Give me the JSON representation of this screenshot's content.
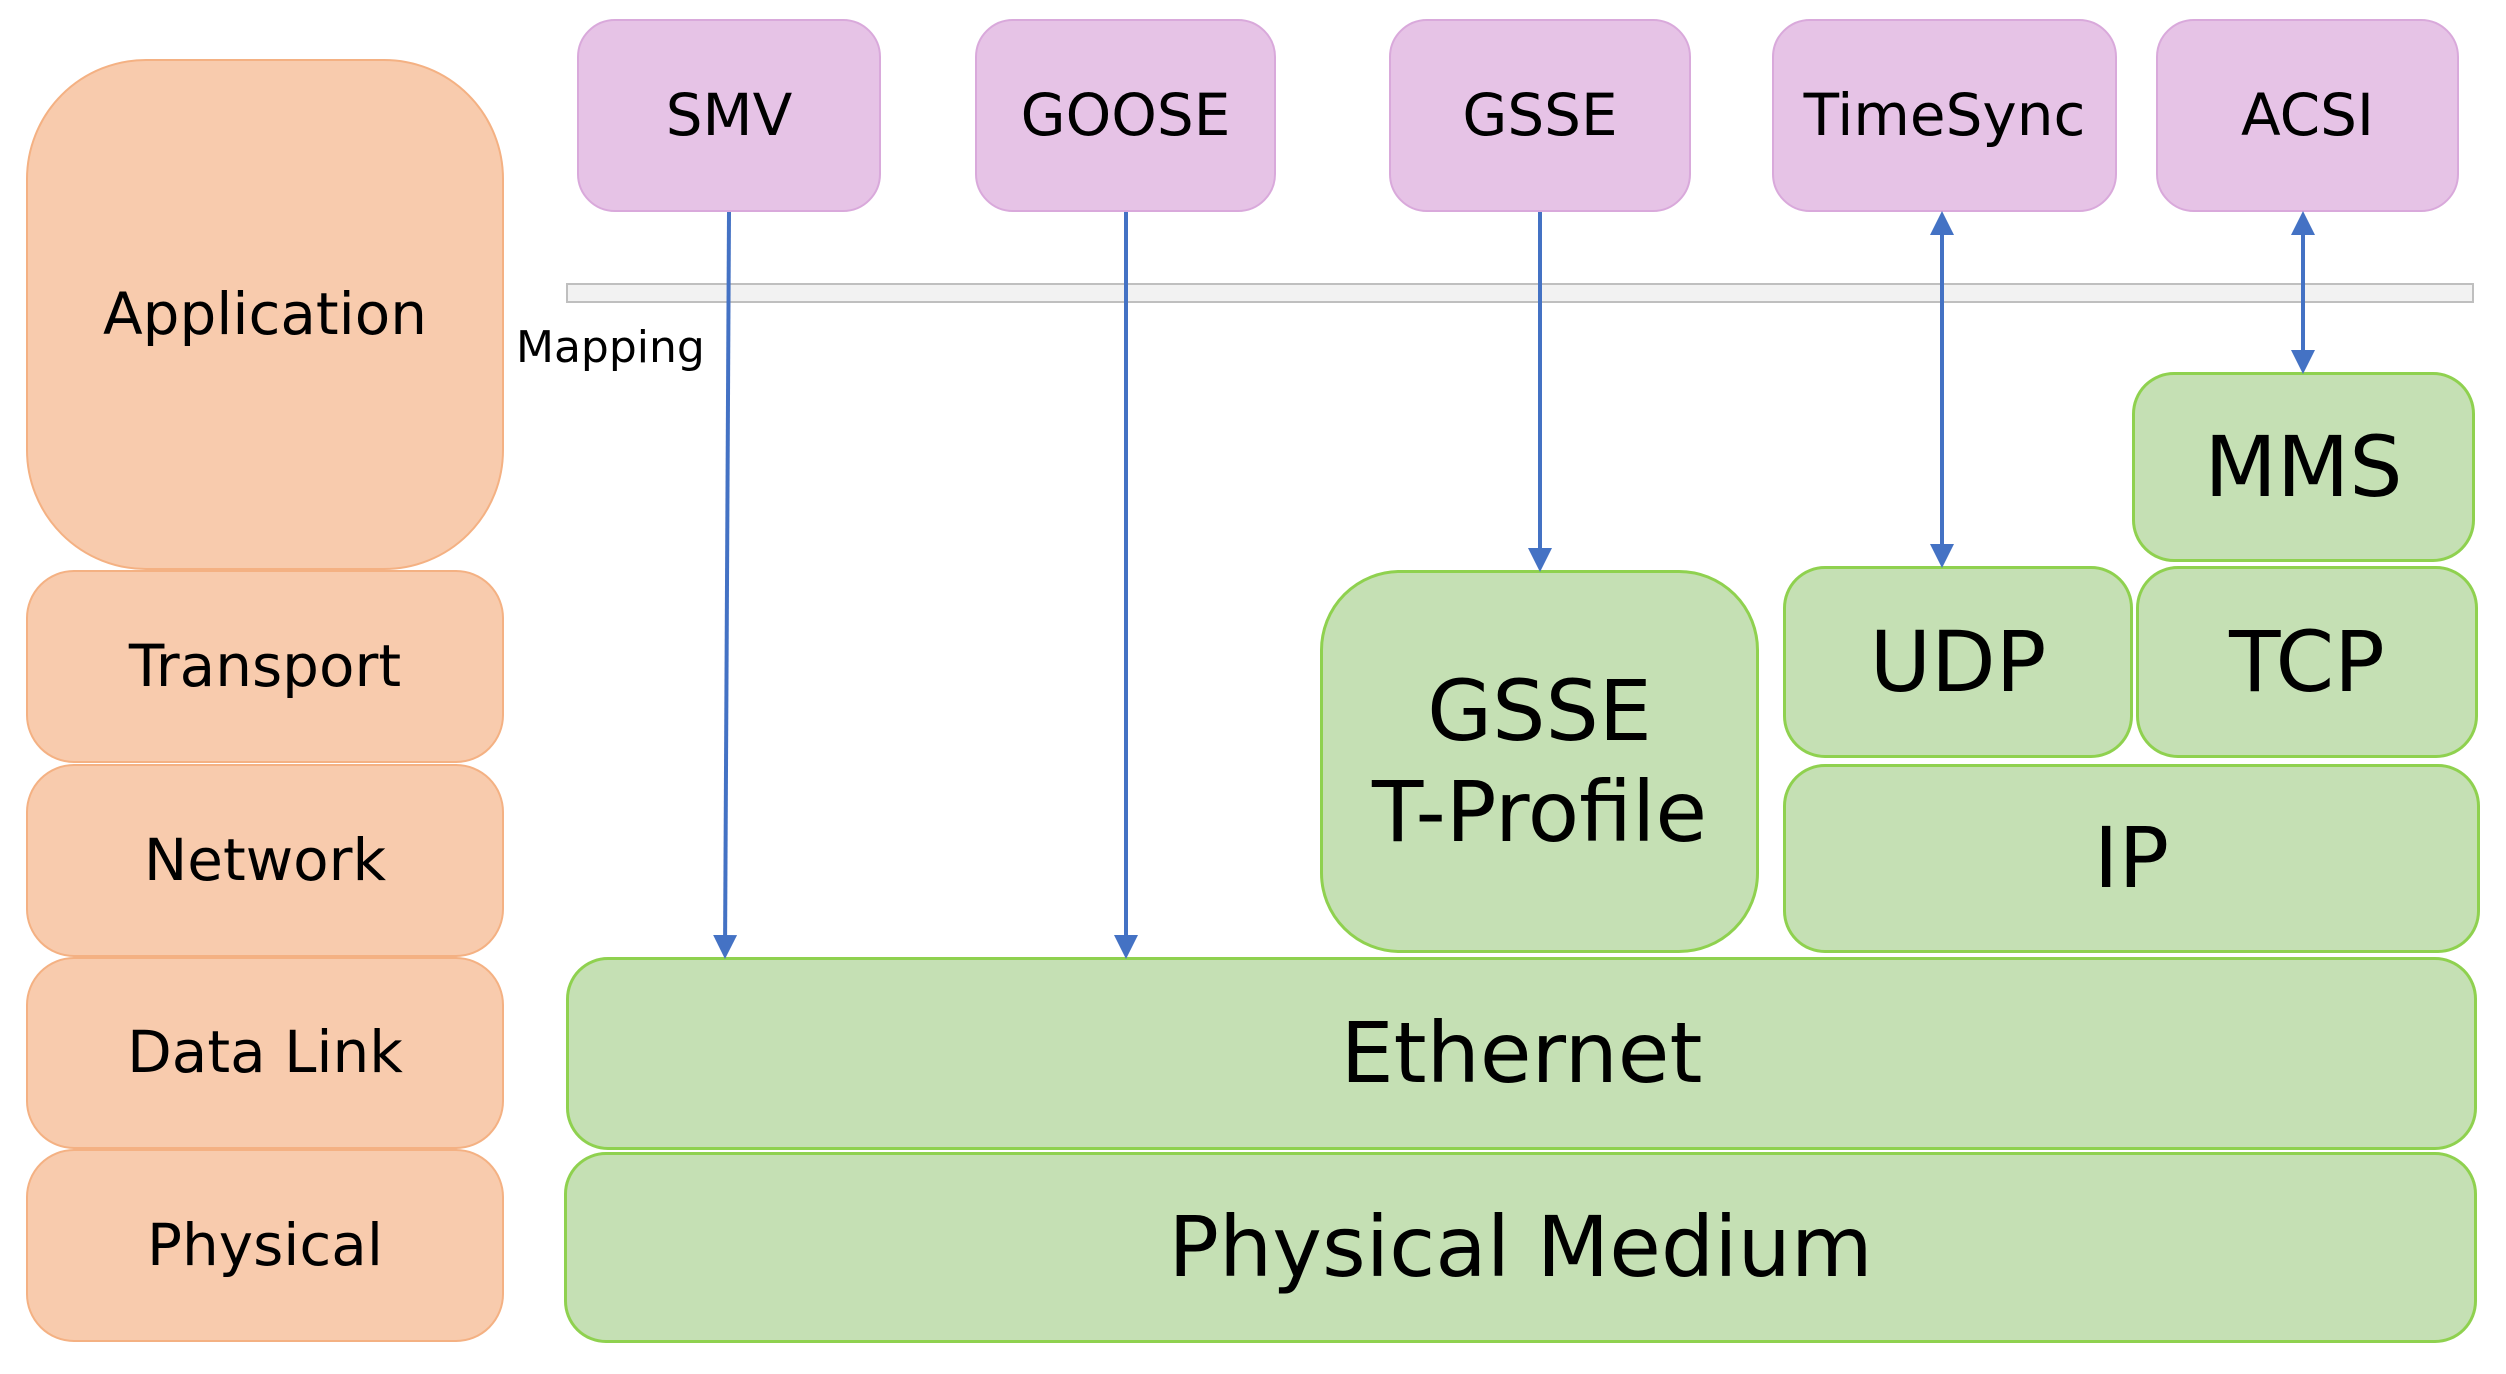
{
  "osi_layers": {
    "application": "Application",
    "transport": "Transport",
    "network": "Network",
    "data_link": "Data Link",
    "physical": "Physical"
  },
  "protocols": {
    "smv": "SMV",
    "goose": "GOOSE",
    "gsse": "GSSE",
    "timesync": "TimeSync",
    "acsi": "ACSI"
  },
  "mapping_label": "Mapping",
  "stack": {
    "mms": "MMS",
    "gsse_tprofile": "GSSE\nT-Profile",
    "udp": "UDP",
    "tcp": "TCP",
    "ip": "IP",
    "ethernet": "Ethernet",
    "physical_medium": "Physical Medium"
  },
  "connections": [
    {
      "from": "SMV",
      "to": "Ethernet",
      "direction": "one-way"
    },
    {
      "from": "GOOSE",
      "to": "Ethernet",
      "direction": "one-way"
    },
    {
      "from": "GSSE",
      "to": "GSSE T-Profile",
      "direction": "one-way"
    },
    {
      "from": "TimeSync",
      "to": "UDP",
      "direction": "two-way"
    },
    {
      "from": "ACSI",
      "to": "MMS",
      "direction": "two-way"
    }
  ],
  "colors": {
    "osi_fill": "#F8CBAD",
    "protocol_fill": "#E6C3E6",
    "stack_fill": "#C5E0B4",
    "arrow": "#4472C4"
  }
}
